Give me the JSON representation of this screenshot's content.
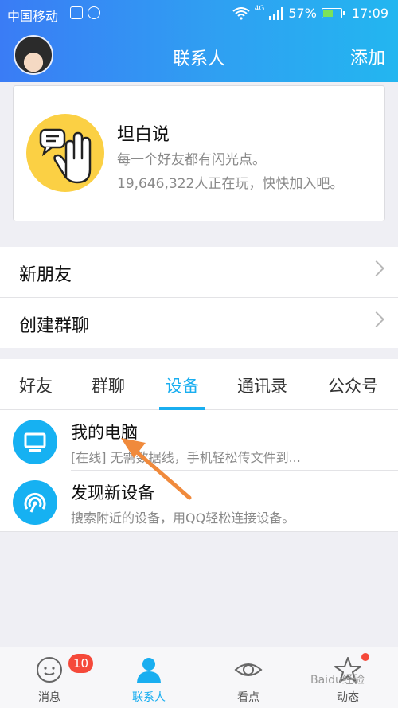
{
  "status_bar": {
    "carrier": "中国移动",
    "network": "4G",
    "battery": "57%",
    "battery_level": 0.57,
    "time": "17:09"
  },
  "header": {
    "title": "联系人",
    "add_label": "添加"
  },
  "banner": {
    "title": "坦白说",
    "line1": "每一个好友都有闪光点。",
    "line2": "19,646,322人正在玩，快快加入吧。"
  },
  "menu": {
    "items": [
      {
        "label": "新朋友"
      },
      {
        "label": "创建群聊"
      }
    ]
  },
  "tabs": {
    "items": [
      {
        "label": "好友"
      },
      {
        "label": "群聊"
      },
      {
        "label": "设备"
      },
      {
        "label": "通讯录"
      },
      {
        "label": "公众号"
      }
    ],
    "active": "设备"
  },
  "devices": [
    {
      "name": "我的电脑",
      "desc": "[在线] 无需数据线，手机轻松传文件到..."
    },
    {
      "name": "发现新设备",
      "desc": "搜索附近的设备，用QQ轻松连接设备。"
    }
  ],
  "bottom_nav": {
    "items": [
      {
        "label": "消息",
        "badge": "10"
      },
      {
        "label": "联系人"
      },
      {
        "label": "看点"
      },
      {
        "label": "动态"
      }
    ]
  },
  "watermark": "Baidu经验",
  "colors": {
    "accent": "#19aef0",
    "badge": "#f5493a",
    "header_start": "#3a7cf5",
    "header_end": "#23b6f0"
  }
}
